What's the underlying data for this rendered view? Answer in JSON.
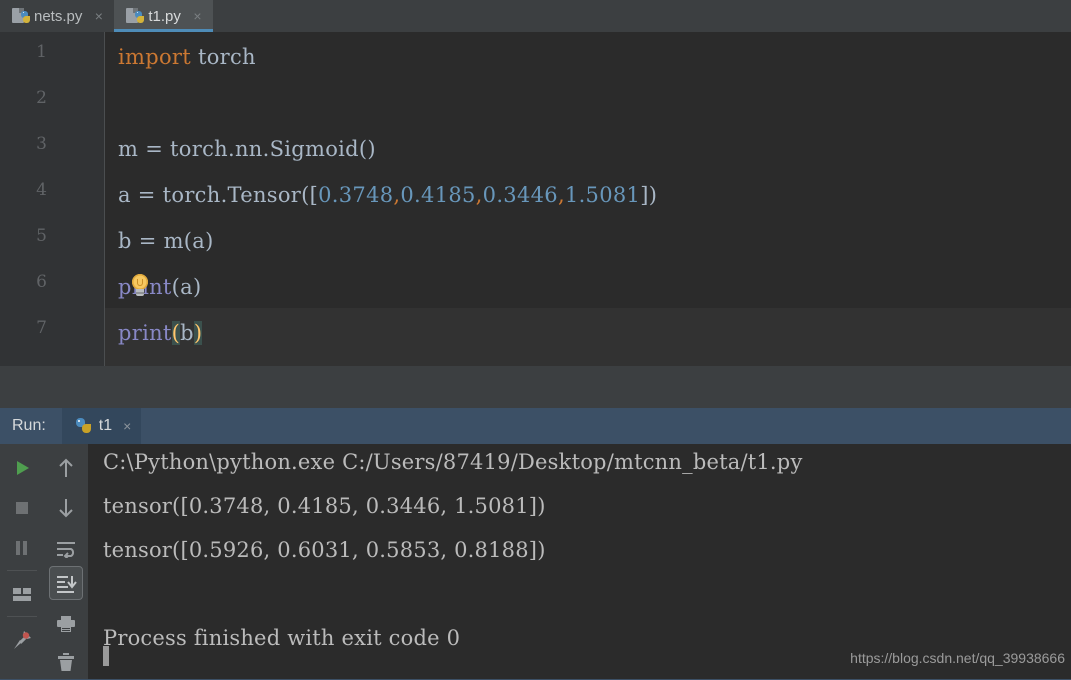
{
  "window": {
    "theme": "darcula",
    "bg": "#2b2b2b",
    "accent": "#4e8cb8"
  },
  "editor_tabs": [
    {
      "label": "nets.py",
      "icon": "python-file-icon",
      "close": "×",
      "active": false
    },
    {
      "label": "t1.py",
      "icon": "python-file-icon",
      "close": "×",
      "active": true
    }
  ],
  "editor": {
    "line_numbers": [
      "1",
      "2",
      "3",
      "4",
      "5",
      "6",
      "7"
    ],
    "caret_line": 7,
    "intention_icon": "lightbulb-icon",
    "lines": [
      {
        "n": "1",
        "text": "import torch"
      },
      {
        "n": "2",
        "text": ""
      },
      {
        "n": "3",
        "text": "m = torch.nn.Sigmoid()"
      },
      {
        "n": "4",
        "text": "a = torch.Tensor([0.3748, 0.4185, 0.3446, 1.5081])"
      },
      {
        "n": "5",
        "text": "b = m(a)"
      },
      {
        "n": "6",
        "text": "print(a)"
      },
      {
        "n": "7",
        "text": "print(b)"
      }
    ],
    "code_text": {
      "l1_kw": "import",
      "l1_mod": " torch",
      "l3_a": "m = torch.nn.Sigmoid()",
      "l4_a": "a = torch.Tensor([",
      "l4_n1": "0.3748",
      "l4_c1": ",",
      "l4_n2": "0.4185",
      "l4_c2": ",",
      "l4_n3": "0.3446",
      "l4_c3": ",",
      "l4_n4": "1.5081",
      "l4_b": "])",
      "l5_a": "b = m(a)",
      "l6_fn": "print",
      "l6_args": "(a)",
      "l7_fn": "print",
      "l7_p1": "(",
      "l7_arg": "b",
      "l7_p2": ")"
    },
    "colors": {
      "keyword": "#cc7832",
      "number": "#6897bb",
      "text": "#a9b7c6",
      "builtin_function": "#8888c6",
      "matched_brace": "#ffc66d",
      "brace_highlight_bg": "#3b514d",
      "line_highlight_bg": "#323232",
      "gutter_bg": "#313335",
      "gutter_fg": "#606366"
    }
  },
  "run_panel": {
    "title": "Run:",
    "tab": {
      "label": "t1",
      "icon": "python-run-icon",
      "close": "×"
    },
    "header_bg": "#3c5066",
    "toolbar_left": [
      {
        "name": "rerun-button",
        "icon": "play-icon",
        "color": "#4f9e4f"
      },
      {
        "name": "stop-button",
        "icon": "stop-square-icon",
        "color": "#6e7173"
      },
      {
        "name": "pause-button",
        "icon": "pause-icon",
        "color": "#6e7173"
      },
      {
        "name": "toggle-tasks-button",
        "icon": "window-layout-icon",
        "color": "#9b9fa2"
      },
      {
        "name": "pin-tab-button",
        "icon": "pin-icon",
        "color": "#9b9fa2"
      }
    ],
    "toolbar_right": [
      {
        "name": "up-stack-trace-button",
        "icon": "arrow-up-icon",
        "color": "#9b9fa2"
      },
      {
        "name": "down-stack-trace-button",
        "icon": "arrow-down-icon",
        "color": "#9b9fa2"
      },
      {
        "name": "soft-wrap-button",
        "icon": "soft-wrap-icon",
        "color": "#9b9fa2"
      },
      {
        "name": "scroll-to-end-button",
        "icon": "scroll-to-end-icon",
        "color": "#c3c6c8",
        "selected": true
      },
      {
        "name": "print-button",
        "icon": "printer-icon",
        "color": "#9b9fa2"
      },
      {
        "name": "clear-all-button",
        "icon": "trash-icon",
        "color": "#9b9fa2"
      }
    ],
    "console": {
      "lines": [
        "C:\\Python\\python.exe C:/Users/87419/Desktop/mtcnn_beta/t1.py",
        "tensor([0.3748, 0.4185, 0.3446, 1.5081])",
        "tensor([0.5926, 0.6031, 0.5853, 0.8188])",
        "",
        "Process finished with exit code 0"
      ],
      "fg": "#bbbbbb",
      "cursor_visible": true
    }
  },
  "watermark": "https://blog.csdn.net/qq_39938666"
}
